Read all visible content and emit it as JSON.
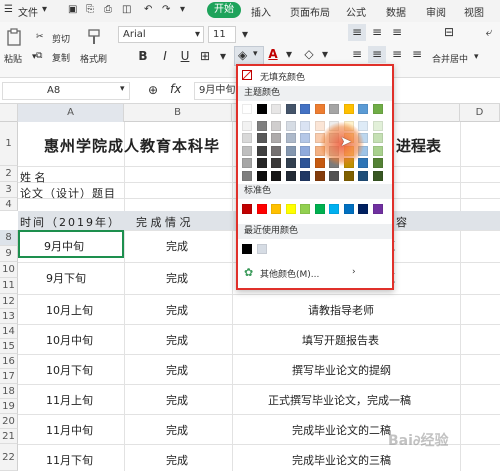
{
  "menu": {
    "file": "文件",
    "start": "开始",
    "insert": "插入",
    "page_layout": "页面布局",
    "formula": "公式",
    "data": "数据",
    "review": "审阅",
    "view": "视图"
  },
  "toolbar": {
    "cut": "剪切",
    "paste": "粘贴",
    "copy": "复制",
    "format_painter": "格式刷",
    "font_name": "Arial",
    "font_size": "11",
    "bold": "B",
    "italic": "I",
    "underline": "U",
    "merge_center": "合并居中"
  },
  "formula_bar": {
    "cell_ref": "A8",
    "value": "9月中旬"
  },
  "columns": [
    "A",
    "B",
    "C",
    "D"
  ],
  "rows": [
    "1",
    "2",
    "3",
    "4",
    "8",
    "9",
    "10",
    "11",
    "12",
    "13",
    "14",
    "15",
    "16",
    "17",
    "18",
    "19",
    "20",
    "21",
    "22"
  ],
  "sheet": {
    "title_left": "惠州学院成人教育本科毕",
    "title_right": "进程表",
    "name_label": "姓       名",
    "thesis_label": "论文（设计）题目",
    "header_time": "时间（2019年）",
    "header_status": "完 成 情 况",
    "header_content": "容",
    "rows": [
      {
        "time": "9月中旬",
        "status": "完成",
        "content": "题"
      },
      {
        "time": "9月下旬",
        "status": "完成",
        "content": "题"
      },
      {
        "time": "10月上旬",
        "status": "完成",
        "content": "请教指导老师"
      },
      {
        "time": "10月中旬",
        "status": "完成",
        "content": "填写开题报告表"
      },
      {
        "time": "10月下旬",
        "status": "完成",
        "content": "撰写毕业论文的提纲"
      },
      {
        "time": "11月上旬",
        "status": "完成",
        "content": "正式撰写毕业论文，完成一稿"
      },
      {
        "time": "11月中旬",
        "status": "完成",
        "content": "完成毕业论文的二稿"
      },
      {
        "time": "11月下旬",
        "status": "完成",
        "content": "完成毕业论文的三稿"
      }
    ]
  },
  "color_dropdown": {
    "no_fill": "无填充颜色",
    "theme_colors": "主题颜色",
    "standard_colors": "标准色",
    "recent_colors": "最近使用颜色",
    "more_colors": "其他颜色(M)...",
    "theme_palette": [
      [
        "#ffffff",
        "#000000",
        "#e7e6e6",
        "#44546a",
        "#4472c4",
        "#ed7d31",
        "#a5a5a5",
        "#ffc000",
        "#5b9bd5",
        "#70ad47"
      ],
      [
        "#f2f2f2",
        "#7f7f7f",
        "#d0cece",
        "#d6dce4",
        "#dae3f3",
        "#fbe5d6",
        "#ededed",
        "#fff2cc",
        "#deebf7",
        "#e2f0d9"
      ],
      [
        "#d9d9d9",
        "#595959",
        "#aeabab",
        "#adb9ca",
        "#b4c7e7",
        "#f8cbad",
        "#dbdbdb",
        "#ffe699",
        "#bdd7ee",
        "#c5e0b4"
      ],
      [
        "#bfbfbf",
        "#404040",
        "#757171",
        "#8497b0",
        "#8faadc",
        "#f4b183",
        "#c9c9c9",
        "#ffd966",
        "#9dc3e6",
        "#a9d18e"
      ],
      [
        "#a6a6a6",
        "#262626",
        "#3a3838",
        "#323f4f",
        "#2f5597",
        "#c55a11",
        "#7b7b7b",
        "#bf9000",
        "#2e75b6",
        "#548235"
      ],
      [
        "#7f7f7f",
        "#0d0d0d",
        "#171616",
        "#222a35",
        "#203864",
        "#843c0c",
        "#525252",
        "#7f6000",
        "#1f4e79",
        "#385723"
      ]
    ],
    "standard_palette": [
      "#c00000",
      "#ff0000",
      "#ffc000",
      "#ffff00",
      "#92d050",
      "#00b050",
      "#00b0f0",
      "#0070c0",
      "#002060",
      "#7030a0"
    ],
    "recent_palette": [
      "#000000",
      "#d6dce4"
    ]
  }
}
